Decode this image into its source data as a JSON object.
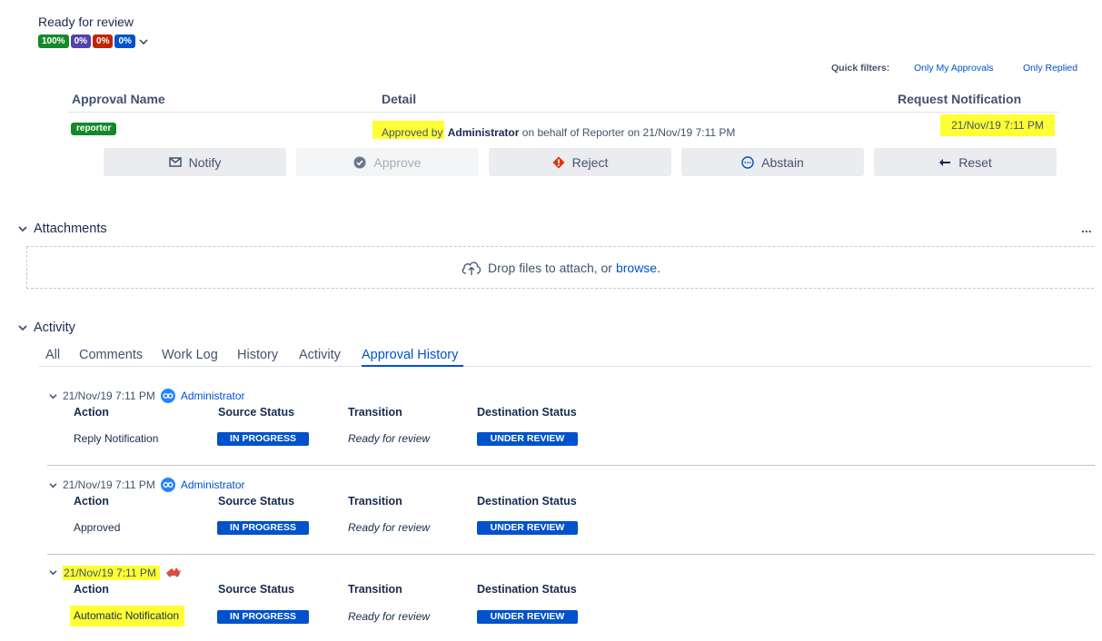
{
  "approval": {
    "status_title": "Ready for review",
    "percentages": [
      {
        "label": "100%",
        "color": "#14892c"
      },
      {
        "label": "0%",
        "color": "#5243aa"
      },
      {
        "label": "0%",
        "color": "#bf2600"
      },
      {
        "label": "0%",
        "color": "#0052cc"
      }
    ],
    "quick_filters_label": "Quick filters:",
    "filter_my_approvals": "Only My Approvals",
    "filter_replied": "Only Replied",
    "columns": {
      "name": "Approval Name",
      "detail": "Detail",
      "notification": "Request Notification"
    },
    "row": {
      "name_badge": "reporter",
      "detail_prefix": "Approved by",
      "detail_user": "Administrator",
      "detail_suffix": "on behalf of Reporter on 21/Nov/19 7:11 PM",
      "notification": "21/Nov/19 7:11 PM"
    },
    "buttons": {
      "notify": "Notify",
      "approve": "Approve",
      "reject": "Reject",
      "abstain": "Abstain",
      "reset": "Reset"
    }
  },
  "attachments": {
    "title": "Attachments",
    "more": "...",
    "drop_text": "Drop files to attach, or",
    "browse": "browse."
  },
  "activity": {
    "title": "Activity",
    "tabs": [
      "All",
      "Comments",
      "Work Log",
      "History",
      "Activity",
      "Approval History"
    ],
    "active_tab": "Approval History",
    "headers": {
      "action": "Action",
      "source": "Source Status",
      "transition": "Transition",
      "destination": "Destination Status"
    },
    "entries": [
      {
        "time": "21/Nov/19 7:11 PM",
        "user": "Administrator",
        "action": "Reply Notification",
        "source": "IN PROGRESS",
        "transition": "Ready for review",
        "destination": "UNDER REVIEW"
      },
      {
        "time": "21/Nov/19 7:11 PM",
        "user": "Administrator",
        "action": "Approved",
        "source": "IN PROGRESS",
        "transition": "Ready for review",
        "destination": "UNDER REVIEW"
      },
      {
        "time": "21/Nov/19 7:11 PM",
        "user": "",
        "action": "Automatic Notification",
        "source": "IN PROGRESS",
        "transition": "Ready for review",
        "destination": "UNDER REVIEW"
      }
    ]
  }
}
